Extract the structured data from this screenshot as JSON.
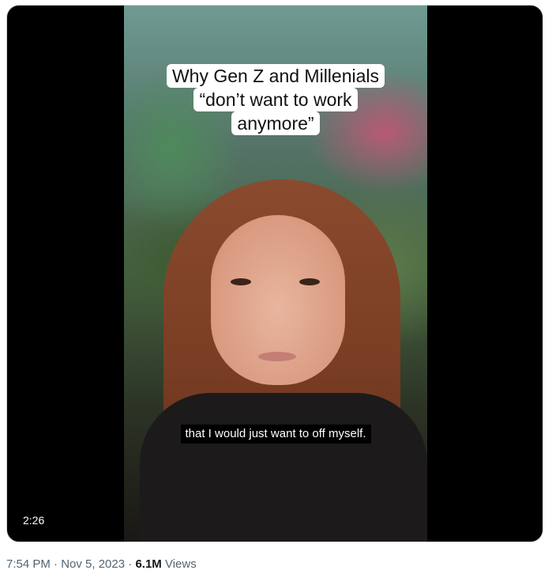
{
  "video": {
    "title_lines": [
      "Why Gen Z and Millenials",
      "“don’t want to work",
      "anymore”"
    ],
    "caption": "that I would just want to off myself.",
    "duration": "2:26"
  },
  "meta": {
    "timestamp": "7:54 PM · Nov 5, 2023",
    "separator": "·",
    "views_count": "6.1M",
    "views_label": "Views"
  },
  "colors": {
    "background": "#ffffff",
    "media_background": "#000000",
    "meta_text": "#536471",
    "primary_text": "#0f1419"
  }
}
